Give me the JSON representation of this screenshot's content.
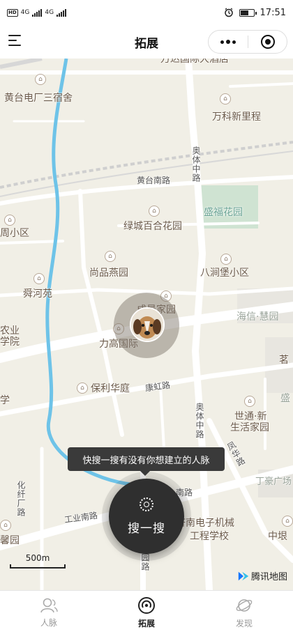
{
  "status_bar": {
    "left_indicators": [
      "HD",
      "4G",
      "4G"
    ],
    "time": "17:51"
  },
  "nav": {
    "title": "拓展",
    "menu_icon": "menu-icon",
    "more_icon": "more-dots-icon",
    "close_icon": "target-circle-icon"
  },
  "map": {
    "pois": [
      {
        "name": "黄台电厂三宿舍"
      },
      {
        "name": "万科新里程"
      },
      {
        "name": "盛福花园"
      },
      {
        "name": "绿城百合花园"
      },
      {
        "name": "周小区"
      },
      {
        "name": "尚品燕园"
      },
      {
        "name": "八涧堡小区"
      },
      {
        "name": "舜河苑"
      },
      {
        "name": "成景家园"
      },
      {
        "name": "海信·慧园"
      },
      {
        "name": "农业"
      },
      {
        "name": "学院"
      },
      {
        "name": "力高国际"
      },
      {
        "name": "茗"
      },
      {
        "name": "保利华庭"
      },
      {
        "name": "学"
      },
      {
        "name": "世通·新"
      },
      {
        "name": "生活家园"
      },
      {
        "name": "盛"
      },
      {
        "name": "丁豪广场"
      },
      {
        "name": "济南电子机械"
      },
      {
        "name": "工程学校"
      },
      {
        "name": "中垠"
      },
      {
        "name": "馨园"
      },
      {
        "name": "万达国际大酒店"
      }
    ],
    "roads": [
      {
        "name": "黄台南路"
      },
      {
        "name": "奥体中路"
      },
      {
        "name": "康虹路"
      },
      {
        "name": "奥体中路"
      },
      {
        "name": "凤华路"
      },
      {
        "name": "化纤厂路"
      },
      {
        "name": "工业南路"
      },
      {
        "name": "南路"
      },
      {
        "name": "园路"
      }
    ],
    "scale_label": "500m",
    "provider": "腾讯地图"
  },
  "tooltip": "快搜一搜有没有你想建立的人脉",
  "search_button": "搜一搜",
  "tabs": [
    {
      "label": "人脉",
      "icon": "person-icon"
    },
    {
      "label": "拓展",
      "icon": "radar-icon"
    },
    {
      "label": "发现",
      "icon": "planet-icon"
    }
  ],
  "colors": {
    "map_bg": "#f1efe6",
    "road": "#ffffff",
    "river": "#6ec3e8",
    "park": "#cfe3d2",
    "button_dark": "#2f2f2f"
  }
}
